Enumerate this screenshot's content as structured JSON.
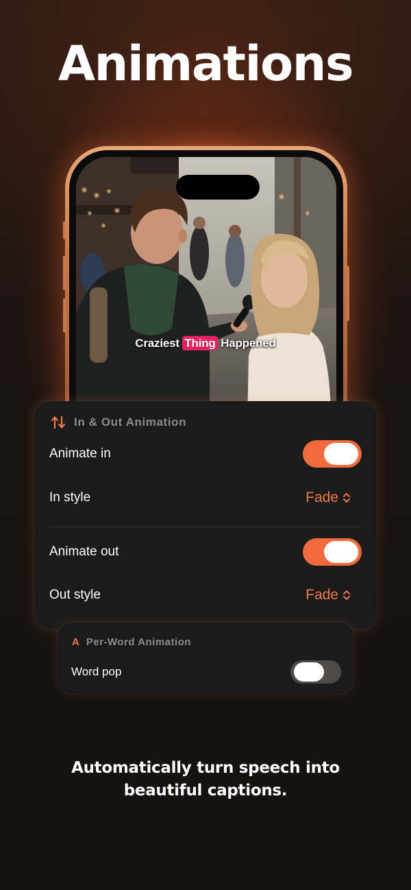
{
  "hero": {
    "title": "Animations"
  },
  "video": {
    "caption_before": "Craziest",
    "caption_highlight": "Thing",
    "caption_after": "Happened",
    "highlight_color": "#e91e63"
  },
  "in_out_panel": {
    "icon": "up-down-arrows-icon",
    "title": "In & Out Animation",
    "animate_in": {
      "label": "Animate in",
      "enabled": true
    },
    "in_style": {
      "label": "In style",
      "value": "Fade"
    },
    "animate_out": {
      "label": "Animate out",
      "enabled": true
    },
    "out_style": {
      "label": "Out style",
      "value": "Fade"
    }
  },
  "per_word_panel": {
    "icon_letter": "A",
    "title": "Per-Word Animation",
    "word_pop": {
      "label": "Word pop",
      "enabled": false
    }
  },
  "tagline": {
    "line1": "Automatically turn speech into",
    "line2": "beautiful captions."
  },
  "colors": {
    "accent": "#f16a3c",
    "panel_bg": "#1c1b1b",
    "background": "#171210"
  }
}
